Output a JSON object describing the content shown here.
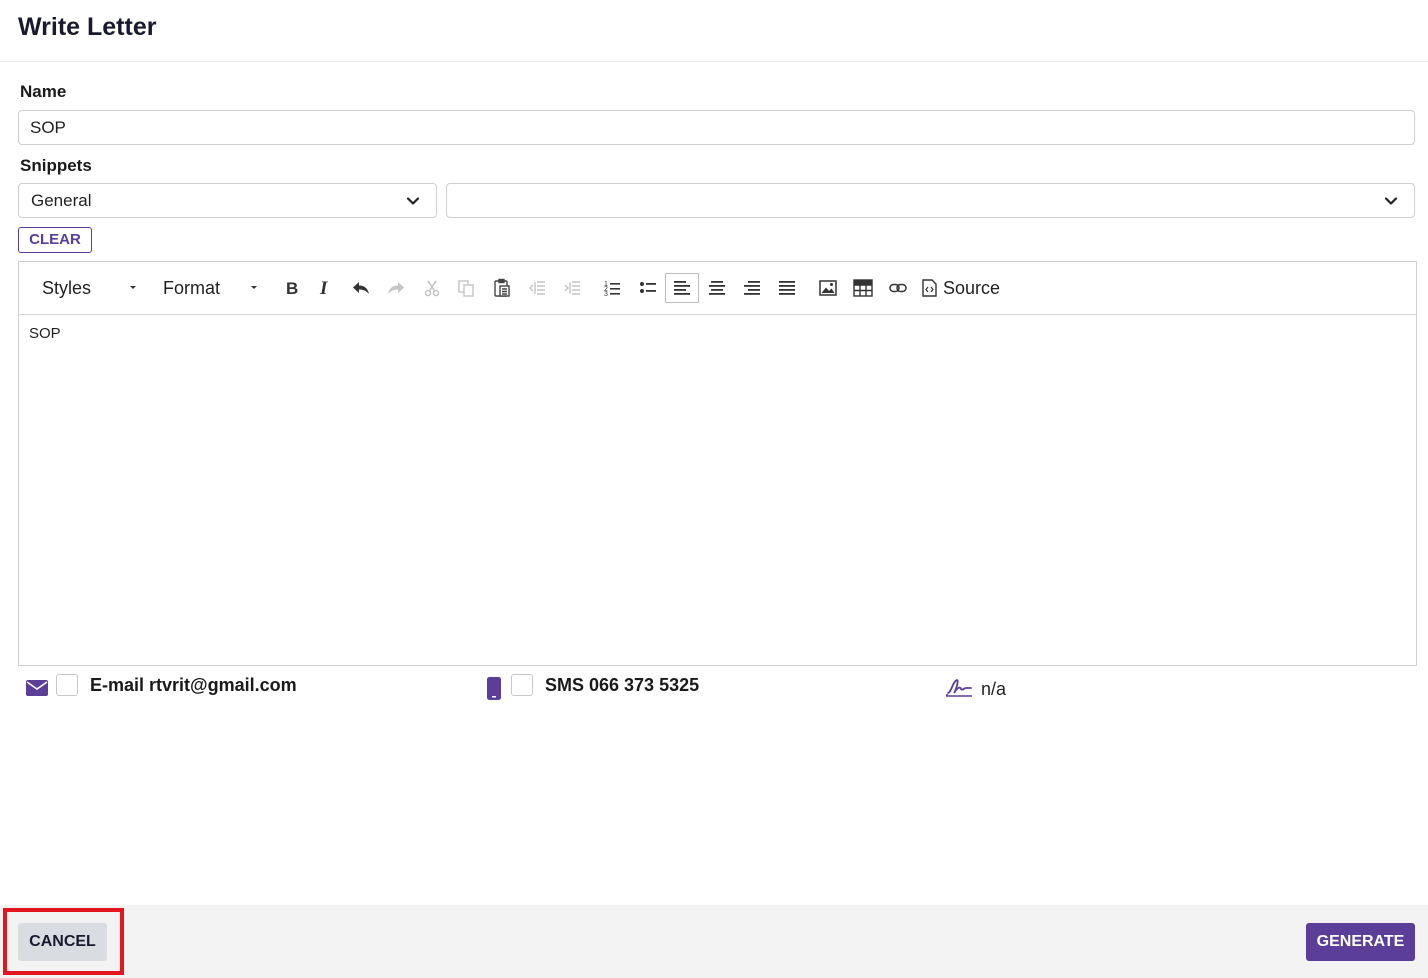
{
  "dialog": {
    "title": "Write Letter"
  },
  "form": {
    "name_label": "Name",
    "name_value": "SOP",
    "snippets_label": "Snippets",
    "snippet_category": "General",
    "snippet_item": "",
    "clear_label": "CLEAR"
  },
  "editor": {
    "styles_label": "Styles",
    "format_label": "Format",
    "source_label": "Source",
    "toolbar_buttons": [
      "bold",
      "italic",
      "undo",
      "redo",
      "cut",
      "copy",
      "paste",
      "outdent",
      "indent",
      "numbered-list",
      "bulleted-list",
      "align-left",
      "align-center",
      "align-right",
      "justify",
      "image",
      "table",
      "link"
    ],
    "active_button": "align-left",
    "content": "SOP"
  },
  "notifications": {
    "email_label": "E-mail rtvrit@gmail.com",
    "email_checked": false,
    "sms_label": "SMS 066 373 5325",
    "sms_checked": false,
    "signature_label": "n/a"
  },
  "footer": {
    "cancel_label": "CANCEL",
    "generate_label": "GENERATE"
  },
  "colors": {
    "accent": "#5b3e98",
    "highlight": "#e3161f",
    "footer_bg": "#f3f3f3",
    "cancel_bg": "#d9dde2"
  }
}
